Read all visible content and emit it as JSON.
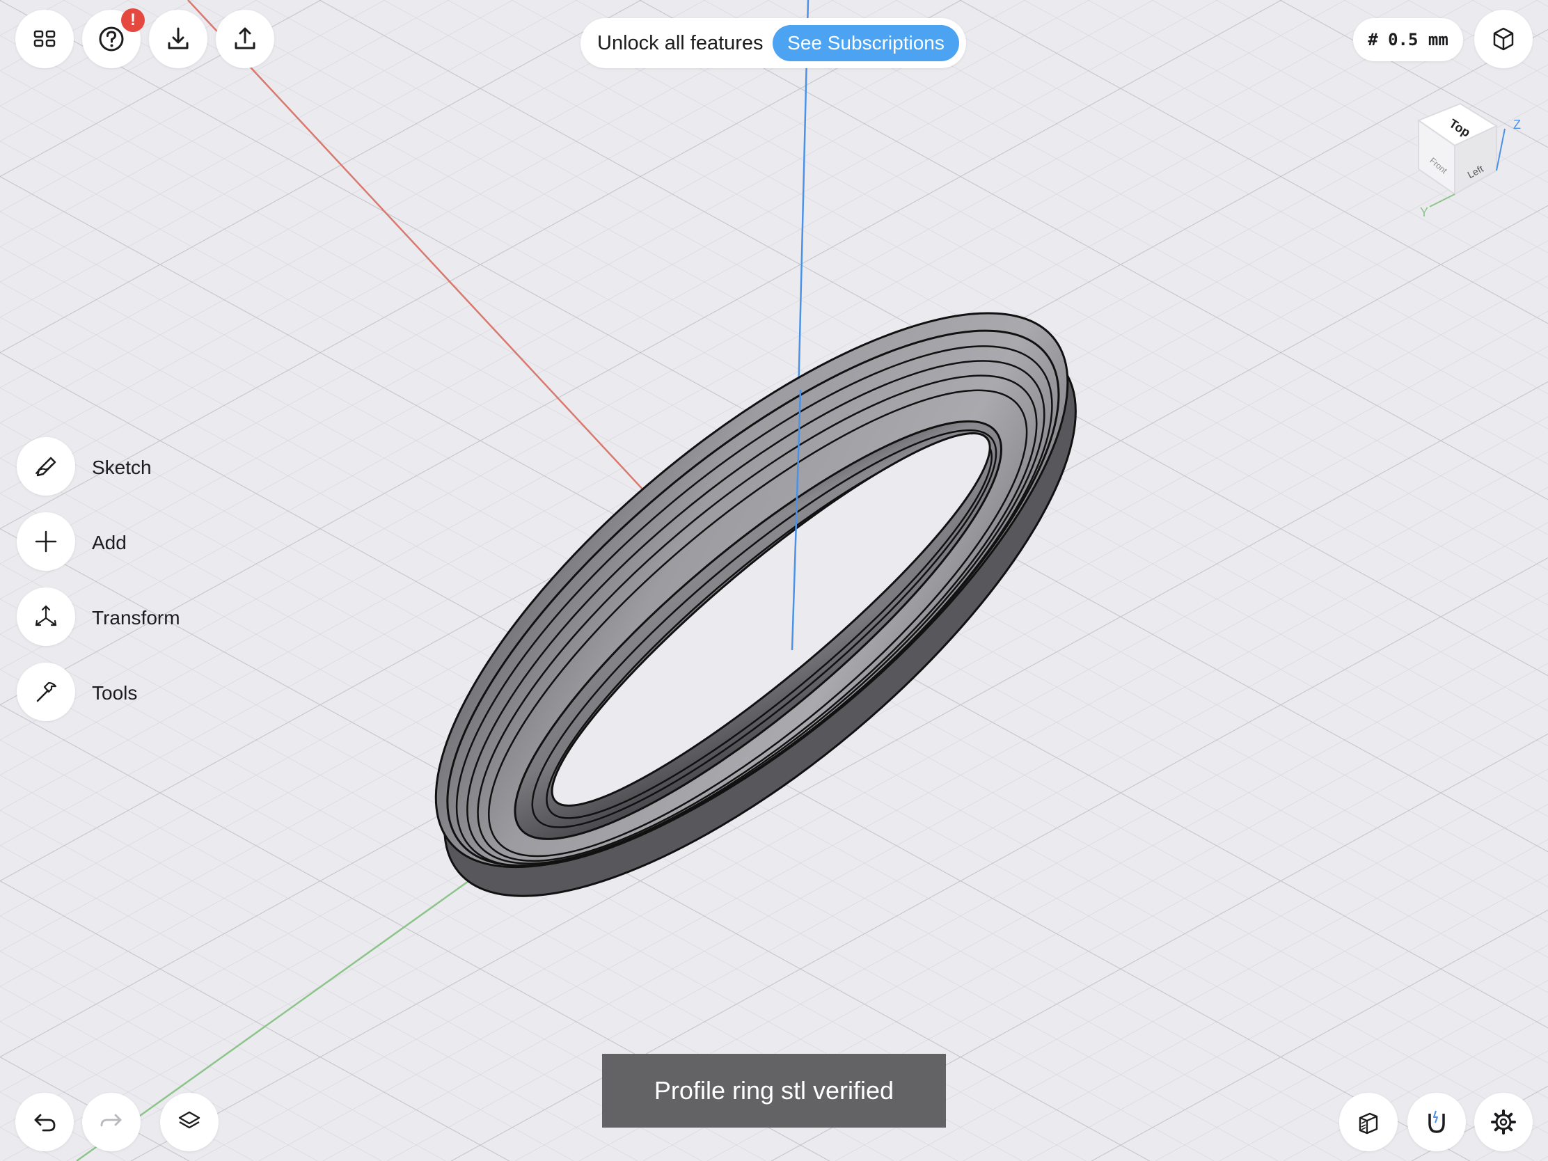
{
  "toolbar": {
    "grid_view_icon": "grid-icon",
    "help_icon": "question-circle-icon",
    "help_badge": "!",
    "import_icon": "download-icon",
    "export_icon": "share-icon"
  },
  "promo": {
    "text": "Unlock all features",
    "button_label": "See Subscriptions",
    "button_color": "#4ba3f2"
  },
  "grid_size": "# 0.5 mm",
  "view_cube": {
    "top_label": "Top",
    "left_label": "Left",
    "front_label": "Front",
    "axis_z": "Z",
    "axis_y": "Y"
  },
  "side_menu": [
    {
      "label": "Sketch",
      "icon": "pencil-icon"
    },
    {
      "label": "Add",
      "icon": "plus-icon"
    },
    {
      "label": "Transform",
      "icon": "move-arrows-icon"
    },
    {
      "label": "Tools",
      "icon": "hammer-icon"
    }
  ],
  "toast": "Profile ring stl verified",
  "bottom_left": {
    "undo_icon": "undo-icon",
    "redo_icon": "redo-icon",
    "layers_icon": "layers-icon"
  },
  "bottom_right": {
    "section_icon": "section-view-icon",
    "snap_icon": "magnet-icon",
    "settings_icon": "gear-icon"
  },
  "colors": {
    "axis_x": "#d9786f",
    "axis_y": "#8cc48a",
    "axis_z": "#4b92e6",
    "badge": "#e5483e",
    "model": "#8e8e93"
  }
}
